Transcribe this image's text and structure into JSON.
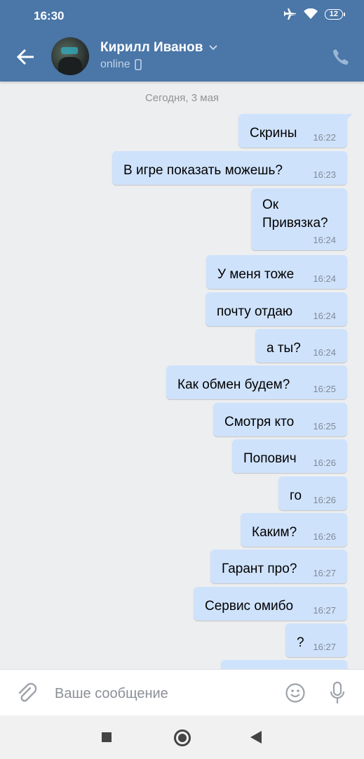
{
  "statusbar": {
    "time": "16:30",
    "battery": "12"
  },
  "header": {
    "name": "Кирилл Иванов",
    "status": "online"
  },
  "date_divider": "Сегодня, 3 мая",
  "messages": [
    {
      "text": "Скрины",
      "time": "16:22"
    },
    {
      "text": "В игре показать можешь?",
      "time": "16:23"
    },
    {
      "text": "Ок\nПривязка?",
      "time": "16:24"
    },
    {
      "text": "У меня тоже",
      "time": "16:24"
    },
    {
      "text": "почту отдаю",
      "time": "16:24"
    },
    {
      "text": "а ты?",
      "time": "16:24"
    },
    {
      "text": "Как обмен будем?",
      "time": "16:25"
    },
    {
      "text": "Смотря кто",
      "time": "16:25"
    },
    {
      "text": "Попович",
      "time": "16:26"
    },
    {
      "text": "го",
      "time": "16:26"
    },
    {
      "text": "Каким?",
      "time": "16:26"
    },
    {
      "text": "Гарант про?",
      "time": "16:27"
    },
    {
      "text": "Сервис омибо",
      "time": "16:27"
    },
    {
      "text": "?",
      "time": "16:27"
    }
  ],
  "composer": {
    "placeholder": "Ваше сообщение"
  },
  "colors": {
    "accent": "#4a76a8",
    "bubble": "#cfe2fb",
    "background": "#edeef0"
  }
}
